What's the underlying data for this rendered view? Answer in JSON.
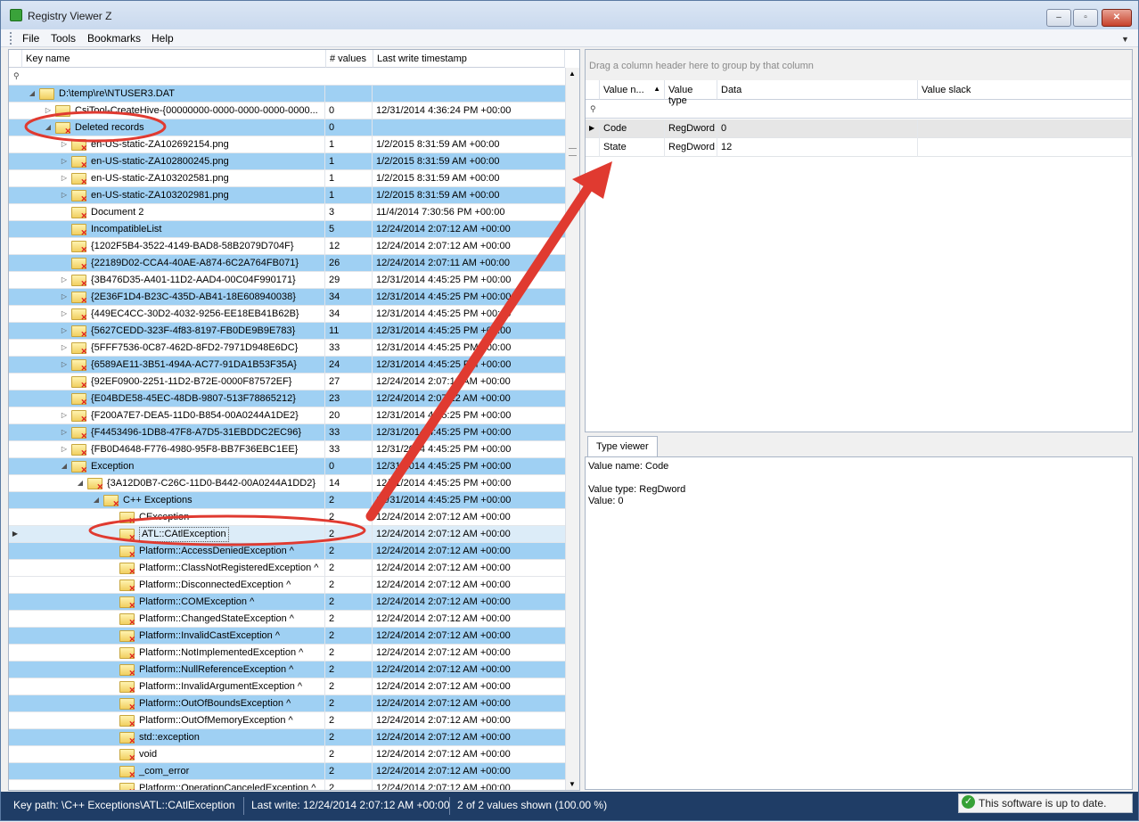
{
  "window": {
    "title": "Registry Viewer Z",
    "min": "–",
    "max": "▫",
    "close": "✕"
  },
  "menu": [
    "File",
    "Tools",
    "Bookmarks",
    "Help"
  ],
  "menu_overflow": "▼",
  "keys_grid": {
    "headers": {
      "key_name": "Key name",
      "num_values": "# values",
      "last_write": "Last write timestamp"
    },
    "filter_pin": "⚲",
    "rows": [
      {
        "indent": 0,
        "exp": "◢",
        "icon": "folder",
        "key": "D:\\temp\\re\\NTUSER3.DAT",
        "n": "",
        "ts": "",
        "alt": true
      },
      {
        "indent": 1,
        "exp": "▷",
        "icon": "folder",
        "key": "CsiTool-CreateHive-{00000000-0000-0000-0000-0000...",
        "n": "0",
        "ts": "12/31/2014 4:36:24 PM +00:00",
        "alt": false
      },
      {
        "indent": 1,
        "exp": "◢",
        "icon": "deleted",
        "key": "Deleted records",
        "n": "0",
        "ts": "",
        "alt": true
      },
      {
        "indent": 2,
        "exp": "▷",
        "icon": "deleted",
        "key": "en-US-static-ZA102692154.png",
        "n": "1",
        "ts": "1/2/2015 8:31:59 AM +00:00",
        "alt": false
      },
      {
        "indent": 2,
        "exp": "▷",
        "icon": "deleted",
        "key": "en-US-static-ZA102800245.png",
        "n": "1",
        "ts": "1/2/2015 8:31:59 AM +00:00",
        "alt": true
      },
      {
        "indent": 2,
        "exp": "▷",
        "icon": "deleted",
        "key": "en-US-static-ZA103202581.png",
        "n": "1",
        "ts": "1/2/2015 8:31:59 AM +00:00",
        "alt": false
      },
      {
        "indent": 2,
        "exp": "▷",
        "icon": "deleted",
        "key": "en-US-static-ZA103202981.png",
        "n": "1",
        "ts": "1/2/2015 8:31:59 AM +00:00",
        "alt": true
      },
      {
        "indent": 2,
        "exp": "",
        "icon": "deleted",
        "key": "Document 2",
        "n": "3",
        "ts": "11/4/2014 7:30:56 PM +00:00",
        "alt": false
      },
      {
        "indent": 2,
        "exp": "",
        "icon": "deleted",
        "key": "IncompatibleList",
        "n": "5",
        "ts": "12/24/2014 2:07:12 AM +00:00",
        "alt": true
      },
      {
        "indent": 2,
        "exp": "",
        "icon": "deleted",
        "key": "{1202F5B4-3522-4149-BAD8-58B2079D704F}",
        "n": "12",
        "ts": "12/24/2014 2:07:12 AM +00:00",
        "alt": false
      },
      {
        "indent": 2,
        "exp": "",
        "icon": "deleted",
        "key": "{22189D02-CCA4-40AE-A874-6C2A764FB071}",
        "n": "26",
        "ts": "12/24/2014 2:07:11 AM +00:00",
        "alt": true
      },
      {
        "indent": 2,
        "exp": "▷",
        "icon": "deleted",
        "key": "{3B476D35-A401-11D2-AAD4-00C04F990171}",
        "n": "29",
        "ts": "12/31/2014 4:45:25 PM +00:00",
        "alt": false
      },
      {
        "indent": 2,
        "exp": "▷",
        "icon": "deleted",
        "key": "{2E36F1D4-B23C-435D-AB41-18E608940038}",
        "n": "34",
        "ts": "12/31/2014 4:45:25 PM +00:00",
        "alt": true
      },
      {
        "indent": 2,
        "exp": "▷",
        "icon": "deleted",
        "key": "{449EC4CC-30D2-4032-9256-EE18EB41B62B}",
        "n": "34",
        "ts": "12/31/2014 4:45:25 PM +00:00",
        "alt": false
      },
      {
        "indent": 2,
        "exp": "▷",
        "icon": "deleted",
        "key": "{5627CEDD-323F-4f83-8197-FB0DE9B9E783}",
        "n": "11",
        "ts": "12/31/2014 4:45:25 PM +00:00",
        "alt": true
      },
      {
        "indent": 2,
        "exp": "▷",
        "icon": "deleted",
        "key": "{5FFF7536-0C87-462D-8FD2-7971D948E6DC}",
        "n": "33",
        "ts": "12/31/2014 4:45:25 PM +00:00",
        "alt": false
      },
      {
        "indent": 2,
        "exp": "▷",
        "icon": "deleted",
        "key": "{6589AE11-3B51-494A-AC77-91DA1B53F35A}",
        "n": "24",
        "ts": "12/31/2014 4:45:25 PM +00:00",
        "alt": true
      },
      {
        "indent": 2,
        "exp": "",
        "icon": "deleted",
        "key": "{92EF0900-2251-11D2-B72E-0000F87572EF}",
        "n": "27",
        "ts": "12/24/2014 2:07:12 AM +00:00",
        "alt": false
      },
      {
        "indent": 2,
        "exp": "",
        "icon": "deleted",
        "key": "{E04BDE58-45EC-48DB-9807-513F78865212}",
        "n": "23",
        "ts": "12/24/2014 2:07:12 AM +00:00",
        "alt": true
      },
      {
        "indent": 2,
        "exp": "▷",
        "icon": "deleted",
        "key": "{F200A7E7-DEA5-11D0-B854-00A0244A1DE2}",
        "n": "20",
        "ts": "12/31/2014 4:45:25 PM +00:00",
        "alt": false
      },
      {
        "indent": 2,
        "exp": "▷",
        "icon": "deleted",
        "key": "{F4453496-1DB8-47F8-A7D5-31EBDDC2EC96}",
        "n": "33",
        "ts": "12/31/2014 4:45:25 PM +00:00",
        "alt": true
      },
      {
        "indent": 2,
        "exp": "▷",
        "icon": "deleted",
        "key": "{FB0D4648-F776-4980-95F8-BB7F36EBC1EE}",
        "n": "33",
        "ts": "12/31/2014 4:45:25 PM +00:00",
        "alt": false
      },
      {
        "indent": 2,
        "exp": "◢",
        "icon": "deleted",
        "key": "Exception",
        "n": "0",
        "ts": "12/31/2014 4:45:25 PM +00:00",
        "alt": true
      },
      {
        "indent": 3,
        "exp": "◢",
        "icon": "deleted",
        "key": "{3A12D0B7-C26C-11D0-B442-00A0244A1DD2}",
        "n": "14",
        "ts": "12/31/2014 4:45:25 PM +00:00",
        "alt": false
      },
      {
        "indent": 4,
        "exp": "◢",
        "icon": "deleted",
        "key": "C++ Exceptions",
        "n": "2",
        "ts": "12/31/2014 4:45:25 PM +00:00",
        "alt": true
      },
      {
        "indent": 5,
        "exp": "",
        "icon": "deleted",
        "key": "CException",
        "n": "2",
        "ts": "12/24/2014 2:07:12 AM +00:00",
        "alt": false
      },
      {
        "indent": 5,
        "exp": "",
        "icon": "deleted",
        "key": "ATL::CAtlException",
        "n": "2",
        "ts": "12/24/2014 2:07:12 AM +00:00",
        "alt": false,
        "selected": true
      },
      {
        "indent": 5,
        "exp": "",
        "icon": "deleted",
        "key": "Platform::AccessDeniedException ^",
        "n": "2",
        "ts": "12/24/2014 2:07:12 AM +00:00",
        "alt": true
      },
      {
        "indent": 5,
        "exp": "",
        "icon": "deleted",
        "key": "Platform::ClassNotRegisteredException ^",
        "n": "2",
        "ts": "12/24/2014 2:07:12 AM +00:00",
        "alt": false
      },
      {
        "indent": 5,
        "exp": "",
        "icon": "deleted",
        "key": "Platform::DisconnectedException ^",
        "n": "2",
        "ts": "12/24/2014 2:07:12 AM +00:00",
        "alt": false
      },
      {
        "indent": 5,
        "exp": "",
        "icon": "deleted",
        "key": "Platform::COMException ^",
        "n": "2",
        "ts": "12/24/2014 2:07:12 AM +00:00",
        "alt": true
      },
      {
        "indent": 5,
        "exp": "",
        "icon": "deleted",
        "key": "Platform::ChangedStateException ^",
        "n": "2",
        "ts": "12/24/2014 2:07:12 AM +00:00",
        "alt": false
      },
      {
        "indent": 5,
        "exp": "",
        "icon": "deleted",
        "key": "Platform::InvalidCastException ^",
        "n": "2",
        "ts": "12/24/2014 2:07:12 AM +00:00",
        "alt": true
      },
      {
        "indent": 5,
        "exp": "",
        "icon": "deleted",
        "key": "Platform::NotImplementedException ^",
        "n": "2",
        "ts": "12/24/2014 2:07:12 AM +00:00",
        "alt": false
      },
      {
        "indent": 5,
        "exp": "",
        "icon": "deleted",
        "key": "Platform::NullReferenceException ^",
        "n": "2",
        "ts": "12/24/2014 2:07:12 AM +00:00",
        "alt": true
      },
      {
        "indent": 5,
        "exp": "",
        "icon": "deleted",
        "key": "Platform::InvalidArgumentException ^",
        "n": "2",
        "ts": "12/24/2014 2:07:12 AM +00:00",
        "alt": false
      },
      {
        "indent": 5,
        "exp": "",
        "icon": "deleted",
        "key": "Platform::OutOfBoundsException ^",
        "n": "2",
        "ts": "12/24/2014 2:07:12 AM +00:00",
        "alt": true
      },
      {
        "indent": 5,
        "exp": "",
        "icon": "deleted",
        "key": "Platform::OutOfMemoryException ^",
        "n": "2",
        "ts": "12/24/2014 2:07:12 AM +00:00",
        "alt": false
      },
      {
        "indent": 5,
        "exp": "",
        "icon": "deleted",
        "key": "std::exception",
        "n": "2",
        "ts": "12/24/2014 2:07:12 AM +00:00",
        "alt": true
      },
      {
        "indent": 5,
        "exp": "",
        "icon": "deleted",
        "key": "void",
        "n": "2",
        "ts": "12/24/2014 2:07:12 AM +00:00",
        "alt": false
      },
      {
        "indent": 5,
        "exp": "",
        "icon": "deleted",
        "key": "_com_error",
        "n": "2",
        "ts": "12/24/2014 2:07:12 AM +00:00",
        "alt": true
      },
      {
        "indent": 5,
        "exp": "",
        "icon": "deleted",
        "key": "Platform::OperationCanceledException ^",
        "n": "2",
        "ts": "12/24/2014 2:07:12 AM +00:00",
        "alt": false
      }
    ]
  },
  "values_grid": {
    "group_hint": "Drag a column header here to group by that column",
    "headers": {
      "name": "Value n...",
      "sort": "▲",
      "type": "Value type",
      "data": "Data",
      "slack": "Value slack"
    },
    "filter_pin": "⚲",
    "rows": [
      {
        "indicator": "▶",
        "name": "Code",
        "type": "RegDword",
        "data": "0"
      },
      {
        "indicator": "",
        "name": "State",
        "type": "RegDword",
        "data": "12"
      }
    ]
  },
  "type_viewer": {
    "tab": "Type viewer",
    "line1": "Value name: Code",
    "line2": "Value type: RegDword",
    "line3": "Value: 0"
  },
  "status": {
    "key_path": "Key path: \\C++ Exceptions\\ATL::CAtlException",
    "last_write": "Last write: 12/24/2014 2:07:12 AM +00:00",
    "values_shown": "2 of 2 values shown (100.00 %)",
    "update": "This software is up to date.",
    "check": "✓"
  },
  "row_indicator": "▶",
  "colors": {
    "alt_row": "#9fd0f3",
    "annotation": "#e03a30",
    "status_bg": "#1f3d66"
  }
}
